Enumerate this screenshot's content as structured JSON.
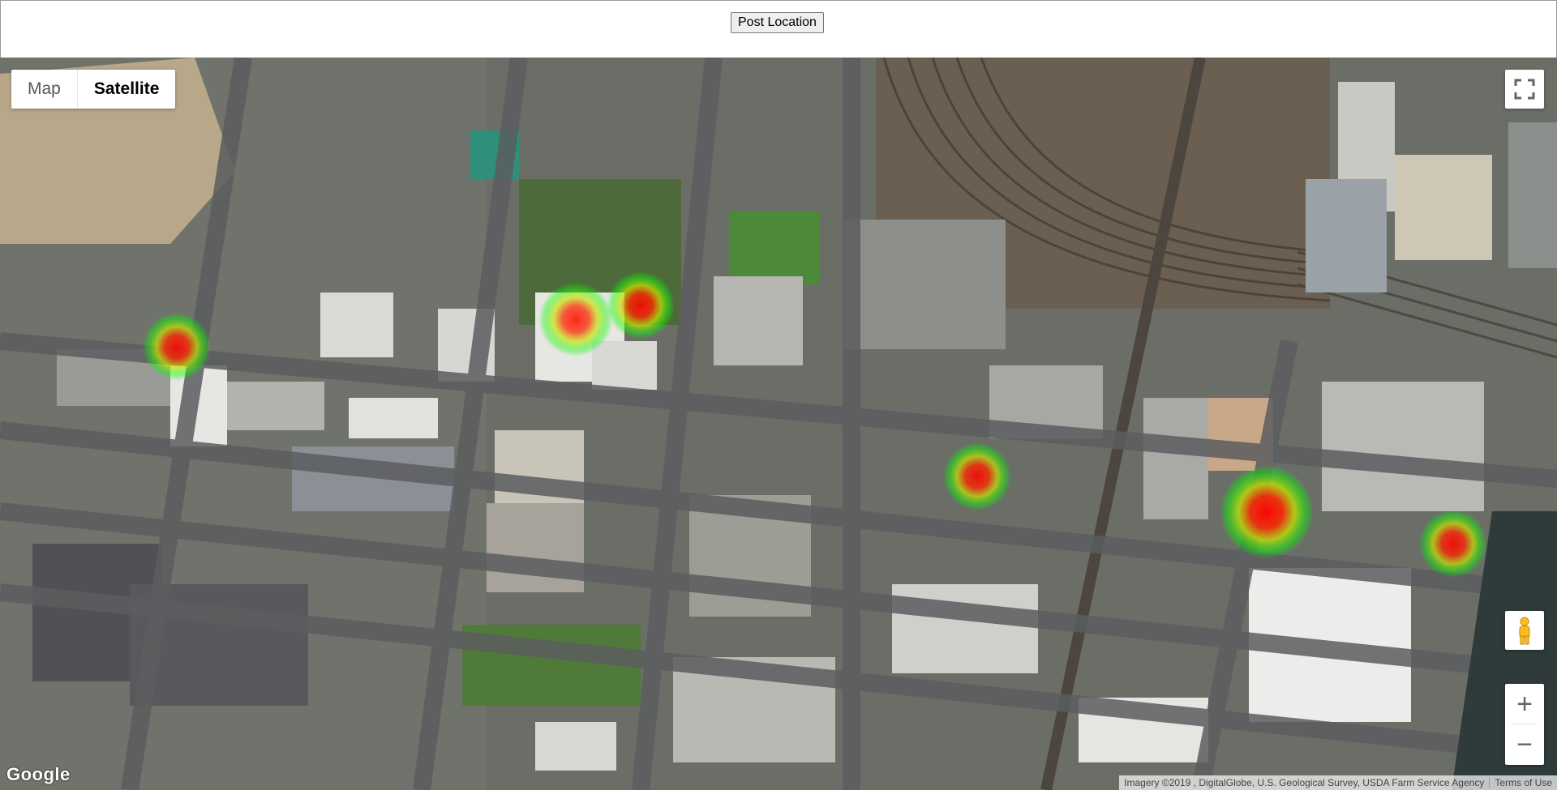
{
  "toolbar": {
    "post_label": "Post Location"
  },
  "map_type": {
    "map_label": "Map",
    "satellite_label": "Satellite",
    "selected": "Satellite"
  },
  "controls": {
    "zoom_in_label": "+",
    "zoom_out_label": "−",
    "fullscreen_icon": "fullscreen-icon",
    "pegman_icon": "pegman-icon"
  },
  "footer": {
    "logo": "Google",
    "attribution": "Imagery ©2019 , DigitalGlobe, U.S. Geological Survey, USDA Farm Service Agency",
    "terms_label": "Terms of Use"
  },
  "heatmap": {
    "gradient": [
      "#00ff00",
      "#ffff00",
      "#ff0000"
    ],
    "points": [
      {
        "name": "heat-spot-west",
        "intensity": 0.8
      },
      {
        "name": "heat-spot-park-1",
        "intensity": 0.7
      },
      {
        "name": "heat-spot-park-2",
        "intensity": 0.85
      },
      {
        "name": "heat-spot-center",
        "intensity": 0.8
      },
      {
        "name": "heat-spot-east",
        "intensity": 1.0
      },
      {
        "name": "heat-spot-far-east",
        "intensity": 0.8
      }
    ]
  }
}
